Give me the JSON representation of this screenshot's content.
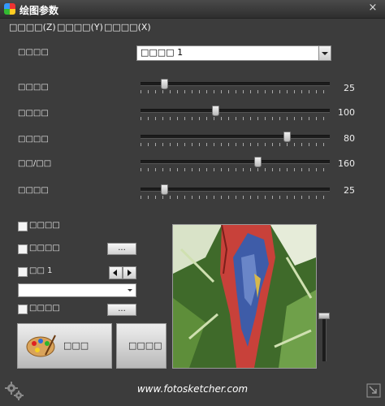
{
  "window": {
    "title": "绘图参数",
    "close_glyph": "×"
  },
  "menu": [
    {
      "label": "□□□□(Z)"
    },
    {
      "label": "□□□□(Y)"
    },
    {
      "label": "□□□□(X)"
    }
  ],
  "preset": {
    "label": "□□□□",
    "value": "□□□□ 1"
  },
  "sliders": [
    {
      "label": "□□□□",
      "value": "25",
      "level": 0.11
    },
    {
      "label": "□□□□",
      "value": "100",
      "level": 0.39
    },
    {
      "label": "□□□□",
      "value": "80",
      "level": 0.78
    },
    {
      "label": "□□/□□",
      "value": "160",
      "level": 0.62
    },
    {
      "label": "□□□□",
      "value": "25",
      "level": 0.11
    }
  ],
  "options": {
    "checkbox1_label": "□□□□",
    "checkbox2_label": "□□□□",
    "browse_label": "...",
    "checkbox3_label": "□□ 1",
    "checkbox4_label": "□□□□",
    "browse2_label": "..."
  },
  "buttons": {
    "draw_label": "□□□",
    "stop_label": "□□□□"
  },
  "footer": {
    "website": "www.fotosketcher.com"
  },
  "zoom_level": 0.95,
  "colors": {
    "window_bg": "#3c3c3c",
    "title_bg": "#2e2e2e"
  },
  "icons": [
    "app-icon",
    "close-icon",
    "dropdown-arrow-icon",
    "left-arrow-icon",
    "right-arrow-icon",
    "palette-icon",
    "settings-gear-icon",
    "resize-icon"
  ]
}
